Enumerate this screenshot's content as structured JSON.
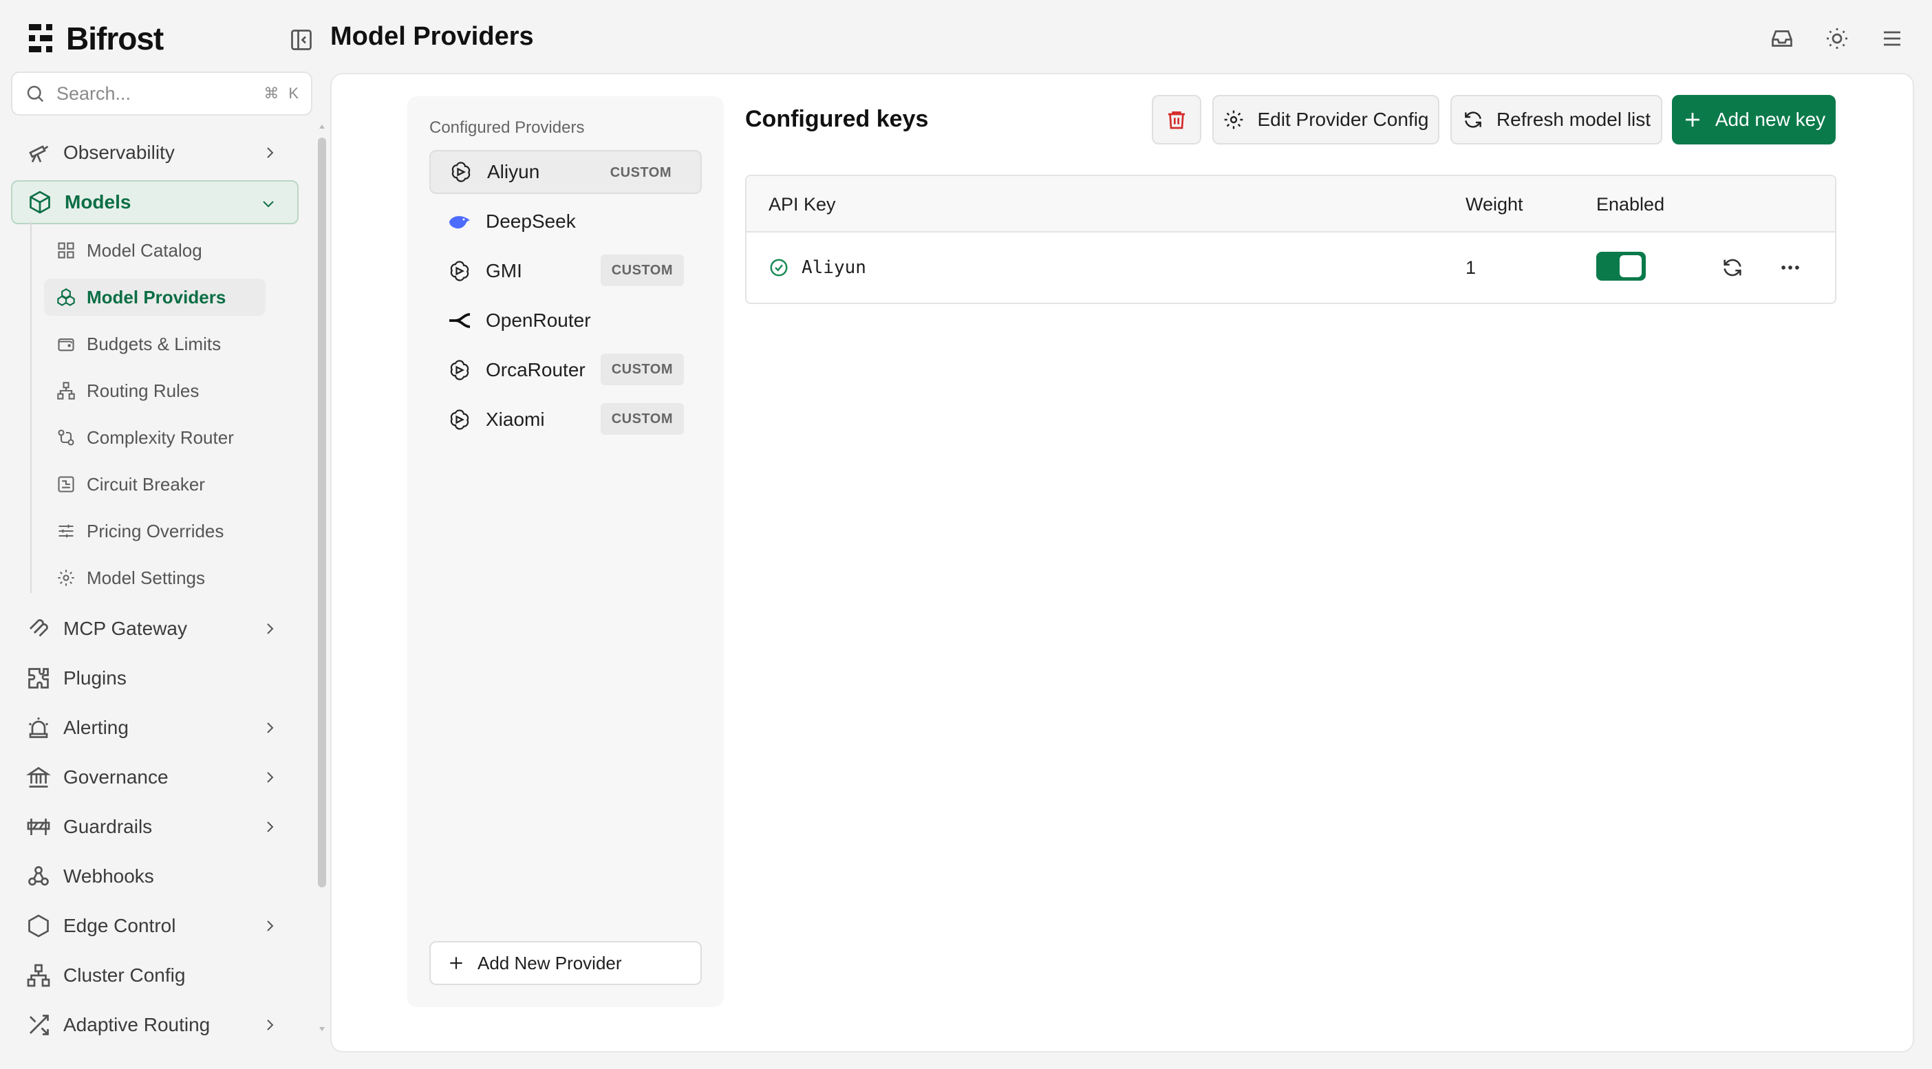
{
  "app": {
    "name": "Bifrost"
  },
  "header": {
    "title": "Model Providers"
  },
  "search": {
    "placeholder": "Search...",
    "shortcut_mod": "⌘",
    "shortcut_key": "K"
  },
  "sidebar": {
    "items": [
      {
        "label": "Observability"
      },
      {
        "label": "Models"
      },
      {
        "label": "MCP Gateway"
      },
      {
        "label": "Plugins"
      },
      {
        "label": "Alerting"
      },
      {
        "label": "Governance"
      },
      {
        "label": "Guardrails"
      },
      {
        "label": "Webhooks"
      },
      {
        "label": "Edge Control"
      },
      {
        "label": "Cluster Config"
      },
      {
        "label": "Adaptive Routing"
      }
    ],
    "models_sub": [
      {
        "label": "Model Catalog"
      },
      {
        "label": "Model Providers"
      },
      {
        "label": "Budgets & Limits"
      },
      {
        "label": "Routing Rules"
      },
      {
        "label": "Complexity Router"
      },
      {
        "label": "Circuit Breaker"
      },
      {
        "label": "Pricing Overrides"
      },
      {
        "label": "Model Settings"
      }
    ]
  },
  "providers": {
    "title": "Configured Providers",
    "items": [
      {
        "name": "Aliyun",
        "badge": "CUSTOM"
      },
      {
        "name": "DeepSeek",
        "badge": ""
      },
      {
        "name": "GMI",
        "badge": "CUSTOM"
      },
      {
        "name": "OpenRouter",
        "badge": ""
      },
      {
        "name": "OrcaRouter",
        "badge": "CUSTOM"
      },
      {
        "name": "Xiaomi",
        "badge": "CUSTOM"
      }
    ],
    "add_label": "Add New Provider"
  },
  "keys": {
    "title": "Configured keys",
    "edit_label": "Edit Provider Config",
    "refresh_label": "Refresh model list",
    "add_label": "Add new key",
    "columns": {
      "key": "API Key",
      "weight": "Weight",
      "enabled": "Enabled"
    },
    "rows": [
      {
        "name": "Aliyun",
        "weight": "1",
        "enabled": true
      }
    ]
  },
  "colors": {
    "accent": "#0b7a4b",
    "active_text": "#0b6e45",
    "danger": "#d42a2a"
  }
}
